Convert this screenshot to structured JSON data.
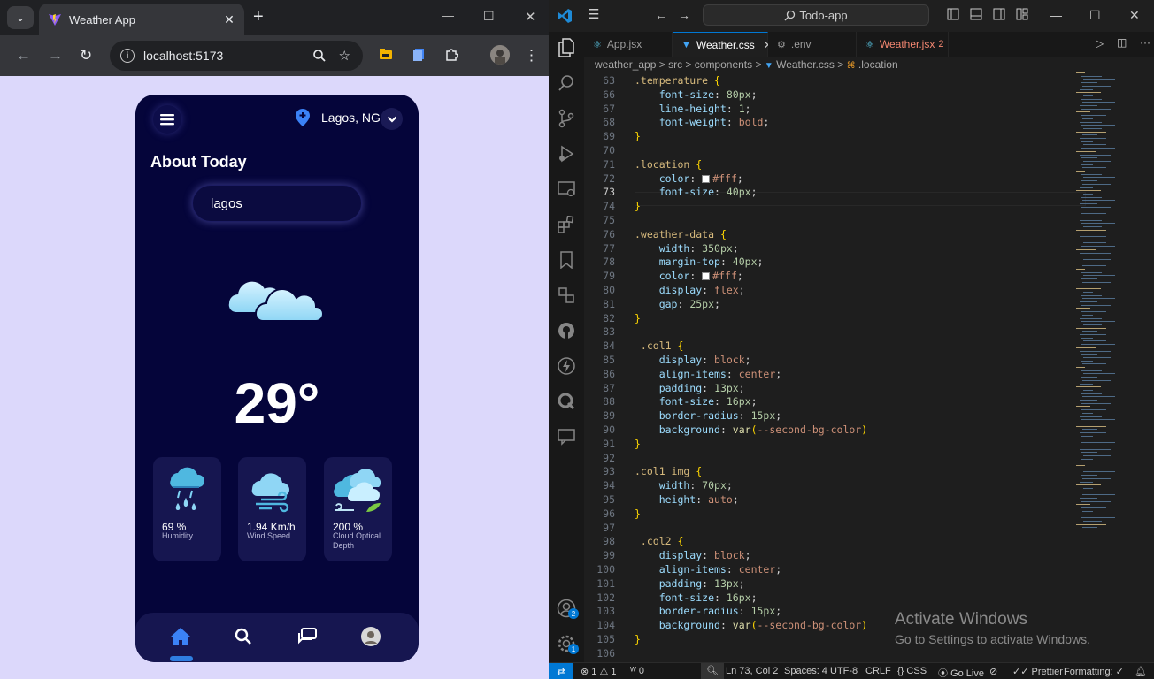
{
  "browser": {
    "tab_title": "Weather App",
    "url": "localhost:5173"
  },
  "app": {
    "location": "Lagos, NG",
    "heading": "About Today",
    "search_value": "lagos",
    "temperature": "29°",
    "stats": [
      {
        "value": "69 %",
        "label": "Humidity"
      },
      {
        "value": "1.94 Km/h",
        "label": "Wind Speed"
      },
      {
        "value": "200 %",
        "label": "Cloud Optical Depth"
      }
    ]
  },
  "vscode": {
    "search_text": "Todo-app",
    "tabs": [
      "App.jsx",
      "Weather.css",
      ".env",
      "Weather.jsx"
    ],
    "tab_problem_count": "2",
    "breadcrumb": [
      "weather_app",
      "src",
      "components",
      "Weather.css",
      ".location"
    ],
    "line_numbers": [
      "63",
      "66",
      "67",
      "68",
      "69",
      "70",
      "71",
      "72",
      "73",
      "74",
      "75",
      "76",
      "77",
      "78",
      "79",
      "80",
      "81",
      "82",
      "83",
      "84",
      "85",
      "86",
      "87",
      "88",
      "89",
      "90",
      "91",
      "92",
      "93",
      "94",
      "95",
      "96",
      "97",
      "98",
      "99",
      "100",
      "101",
      "102",
      "103",
      "104",
      "105",
      "106"
    ],
    "current_line": "73",
    "activate_title": "Activate Windows",
    "activate_sub": "Go to Settings to activate Windows.",
    "status": {
      "errors": "1",
      "warnings": "1",
      "ports": "0",
      "position": "Ln 73, Col 2",
      "spaces": "Spaces: 4",
      "encoding": "UTF-8",
      "eol": "CRLF",
      "language": "CSS",
      "golive": "Go Live",
      "prettier": "Prettier",
      "formatting": "Formatting: ✓"
    },
    "account_badge": "2",
    "settings_badge": "1"
  },
  "colors": {
    "app_bg": "#05053a",
    "page_bg": "#dcd8fb",
    "accent_blue": "#0078d4"
  }
}
